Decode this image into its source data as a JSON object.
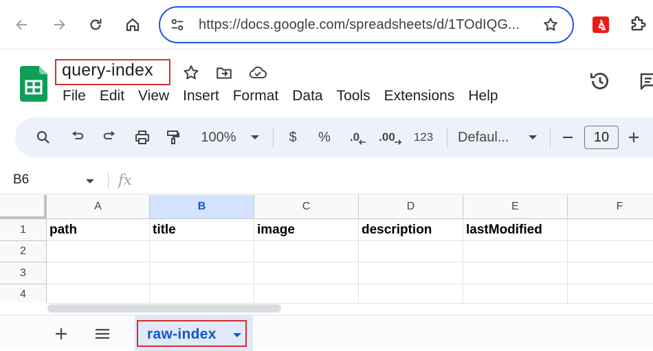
{
  "browser": {
    "url": "https://docs.google.com/spreadsheets/d/1TOdIQG..."
  },
  "doc": {
    "title": "query-index"
  },
  "menu": [
    "File",
    "Edit",
    "View",
    "Insert",
    "Format",
    "Data",
    "Tools",
    "Extensions",
    "Help"
  ],
  "toolbar": {
    "zoom": "100%",
    "currency": "$",
    "percent": "%",
    "decrease_decimal": ".0",
    "increase_decimal": ".00",
    "number_format": "123",
    "font": "Defaul...",
    "font_size": "10"
  },
  "formula_bar": {
    "cell_ref": "B6",
    "fx": "fx",
    "value": ""
  },
  "grid": {
    "selected_column": "B",
    "columns": [
      "A",
      "B",
      "C",
      "D",
      "E",
      "F"
    ],
    "rows": [
      {
        "num": "1",
        "cells": [
          "path",
          "title",
          "image",
          "description",
          "lastModified",
          ""
        ]
      },
      {
        "num": "2",
        "cells": [
          "",
          "",
          "",
          "",
          "",
          ""
        ]
      },
      {
        "num": "3",
        "cells": [
          "",
          "",
          "",
          "",
          "",
          ""
        ]
      },
      {
        "num": "4",
        "cells": [
          "",
          "",
          "",
          "",
          "",
          ""
        ]
      }
    ]
  },
  "sheets": {
    "active_tab": "raw-index"
  },
  "colors": {
    "accent": "#0b57d0",
    "highlight_box": "#d32f2f",
    "sheets_green": "#0f9d58"
  }
}
